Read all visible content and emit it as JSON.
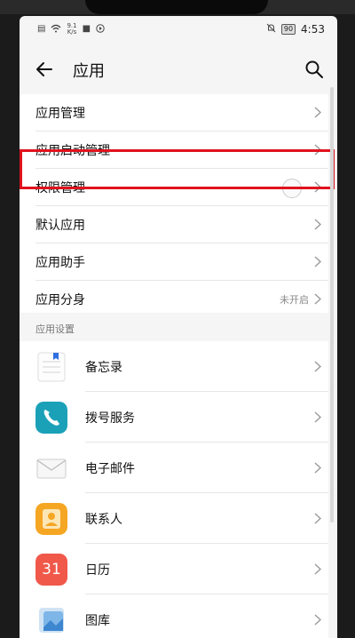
{
  "status_bar": {
    "speed_value": "9.1",
    "speed_unit": "K/s",
    "battery": "90",
    "time": "4:53"
  },
  "header": {
    "title": "应用"
  },
  "settings_list": [
    {
      "label": "应用管理",
      "value": ""
    },
    {
      "label": "应用启动管理",
      "value": ""
    },
    {
      "label": "权限管理",
      "value": "",
      "highlighted": true
    },
    {
      "label": "默认应用",
      "value": ""
    },
    {
      "label": "应用助手",
      "value": ""
    },
    {
      "label": "应用分身",
      "value": "未开启"
    }
  ],
  "section": {
    "title": "应用设置"
  },
  "apps": [
    {
      "name": "备忘录",
      "icon": "memo-icon"
    },
    {
      "name": "拨号服务",
      "icon": "phone-icon"
    },
    {
      "name": "电子邮件",
      "icon": "mail-icon"
    },
    {
      "name": "联系人",
      "icon": "contacts-icon"
    },
    {
      "name": "日历",
      "icon": "calendar-icon",
      "icon_text": "31"
    },
    {
      "name": "图库",
      "icon": "gallery-icon"
    }
  ],
  "colors": {
    "highlight": "#e0131d",
    "phone_app": "#1aa1b8",
    "contacts_app": "#f5a623",
    "calendar_app": "#f0584a"
  }
}
